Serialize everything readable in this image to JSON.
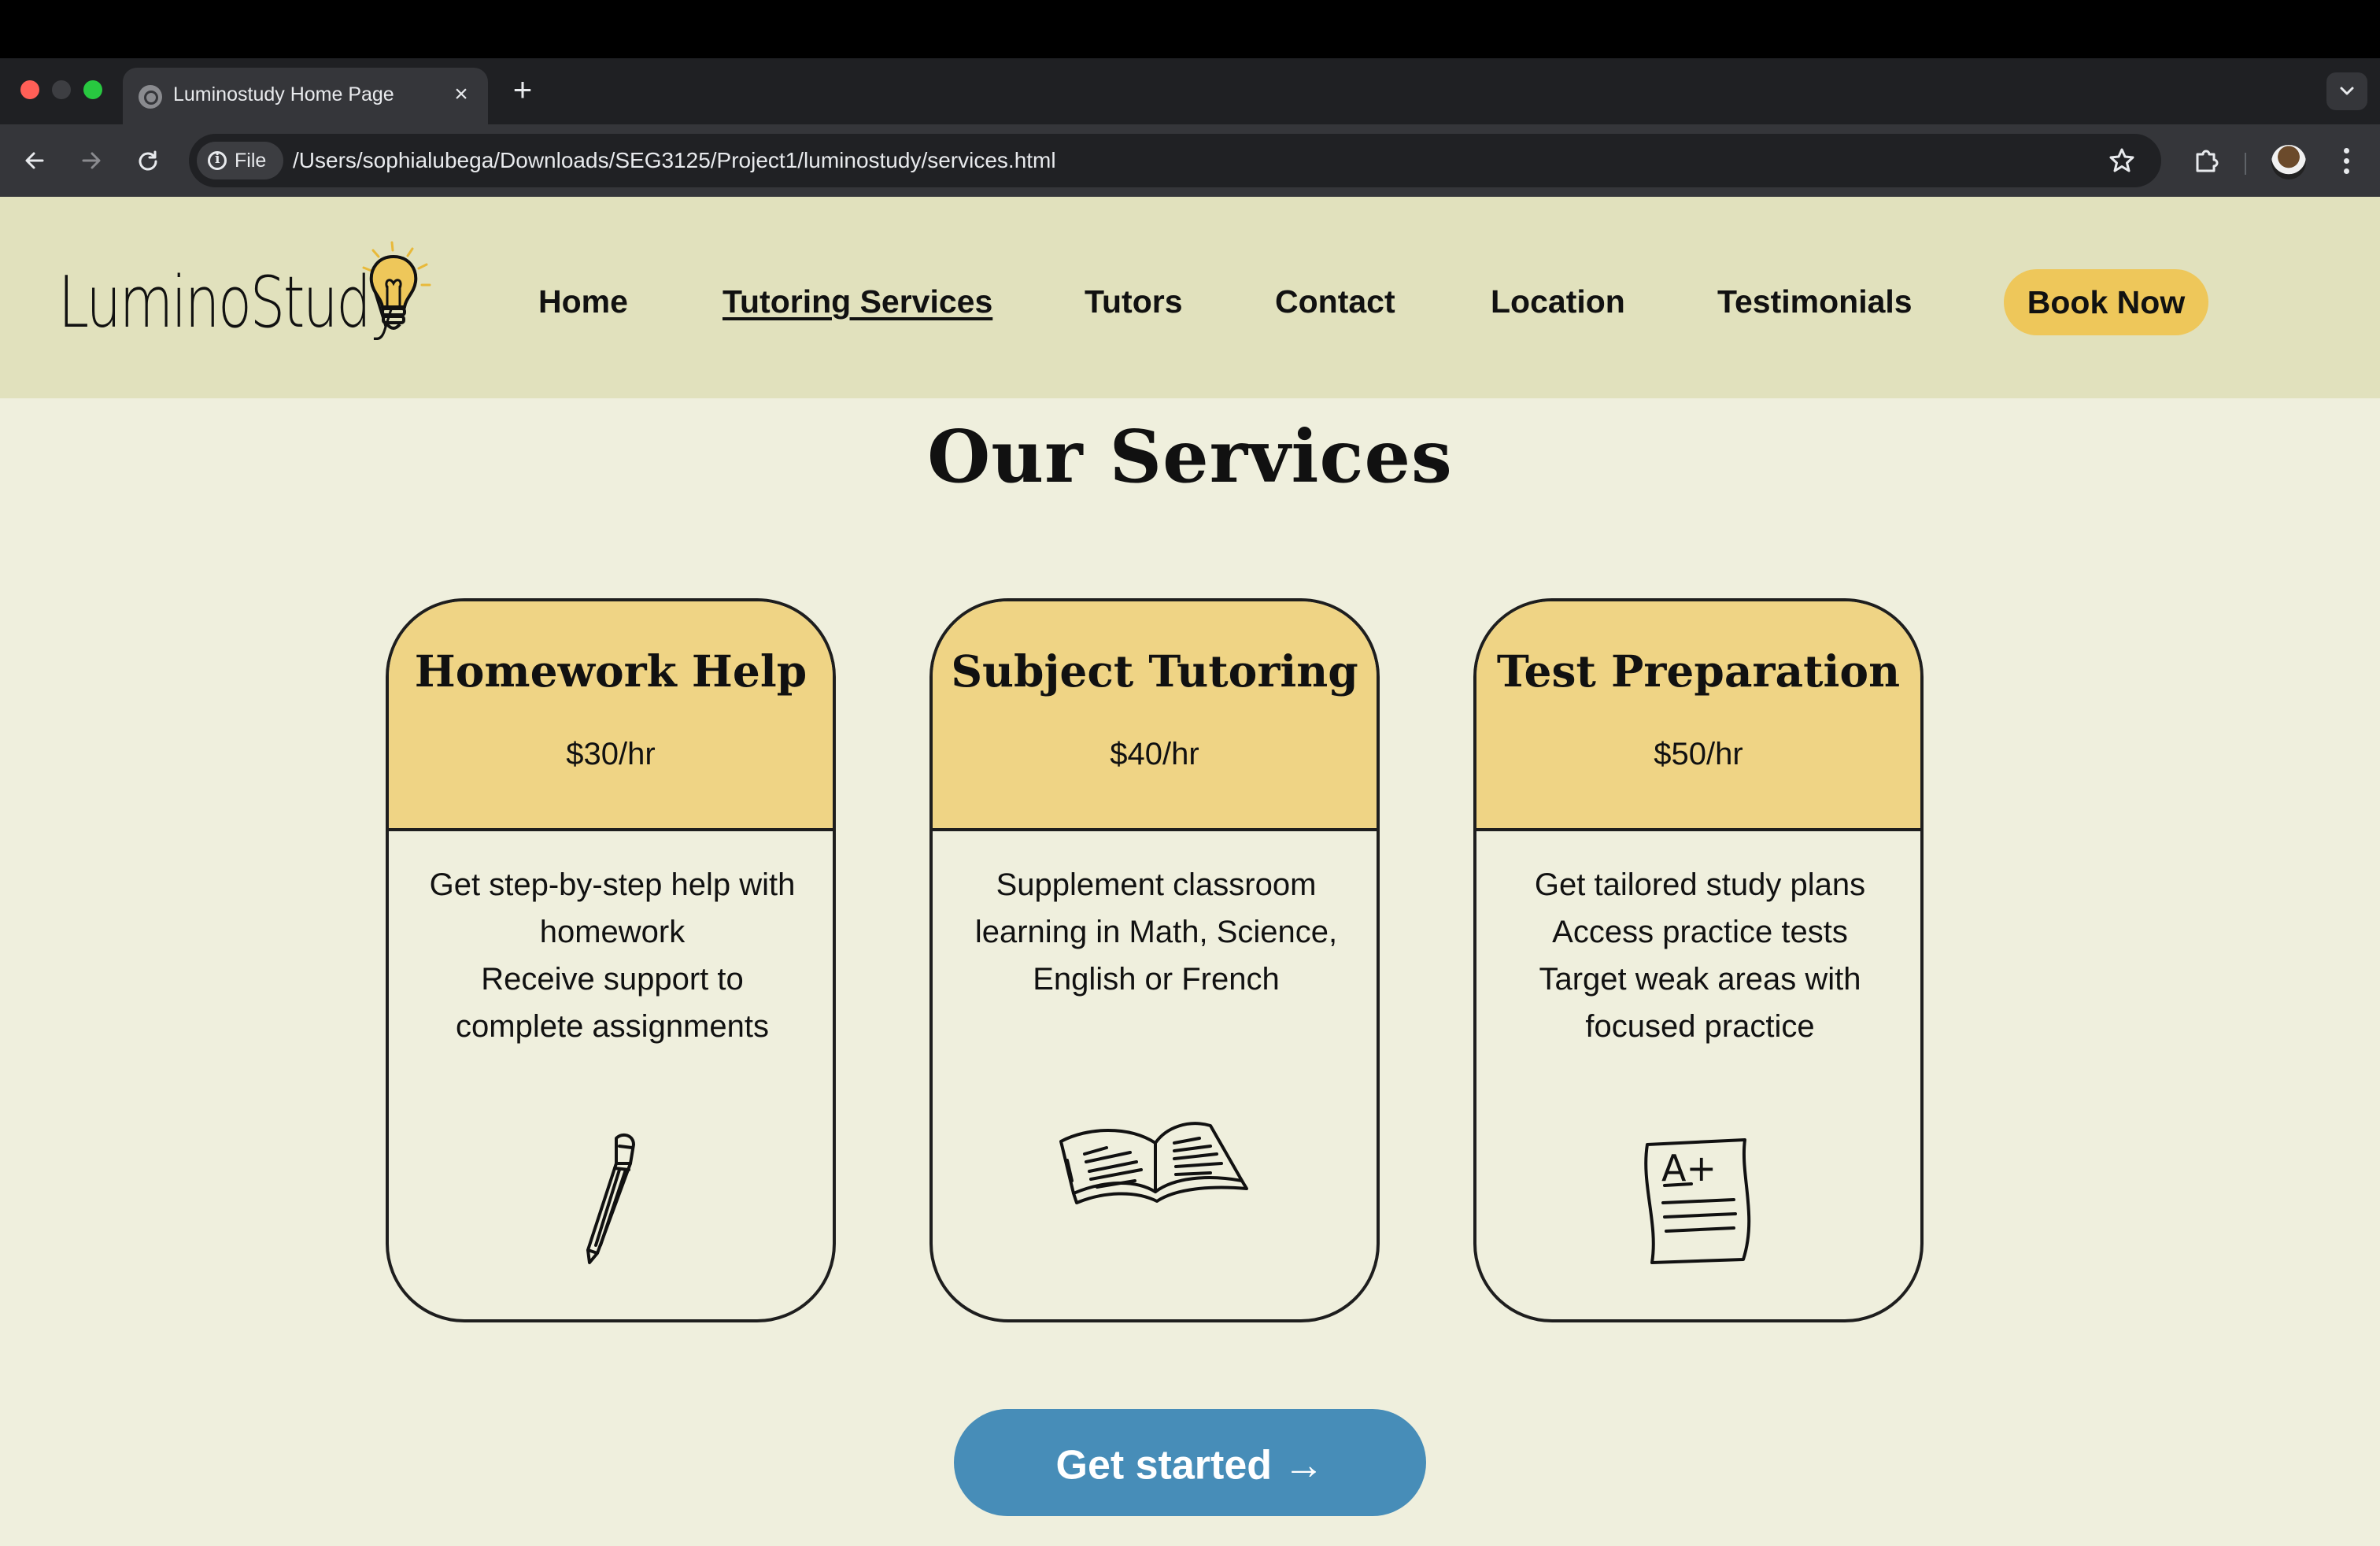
{
  "browser": {
    "tab_title": "Luminostudy Home Page",
    "tab_close": "×",
    "new_tab": "+",
    "chip_label": "File",
    "url": "/Users/sophialubega/Downloads/SEG3125/Project1/luminostudy/services.html"
  },
  "site": {
    "logo_text": "LuminoStudy",
    "nav": {
      "home": "Home",
      "tutoring_services": "Tutoring Services",
      "tutors": "Tutors",
      "contact": "Contact",
      "location": "Location",
      "testimonials": "Testimonials"
    },
    "book_now": "Book Now",
    "page_title": "Our Services",
    "get_started": "Get started",
    "get_started_arrow": "→",
    "colors": {
      "header_bg": "#e1e1bd",
      "page_bg": "#efefdd",
      "accent_yellow": "#eec75a",
      "card_head": "#efd485",
      "cta_blue": "#478db8"
    }
  },
  "services": [
    {
      "title": "Homework Help",
      "price": "$30/hr",
      "lines": [
        "Get step-by-step help with",
        "homework",
        "Receive support to",
        "complete assignments"
      ],
      "icon": "pencil-icon"
    },
    {
      "title": "Subject Tutoring",
      "price": "$40/hr",
      "lines": [
        "Supplement classroom",
        "learning in Math, Science,",
        "English or French"
      ],
      "icon": "open-book-icon"
    },
    {
      "title": "Test Preparation",
      "price": "$50/hr",
      "lines": [
        "Get tailored study plans",
        "Access practice tests",
        "Target weak areas with",
        "focused practice"
      ],
      "icon": "graded-test-icon"
    }
  ],
  "icon_labels": {
    "test_grade": "A+"
  }
}
